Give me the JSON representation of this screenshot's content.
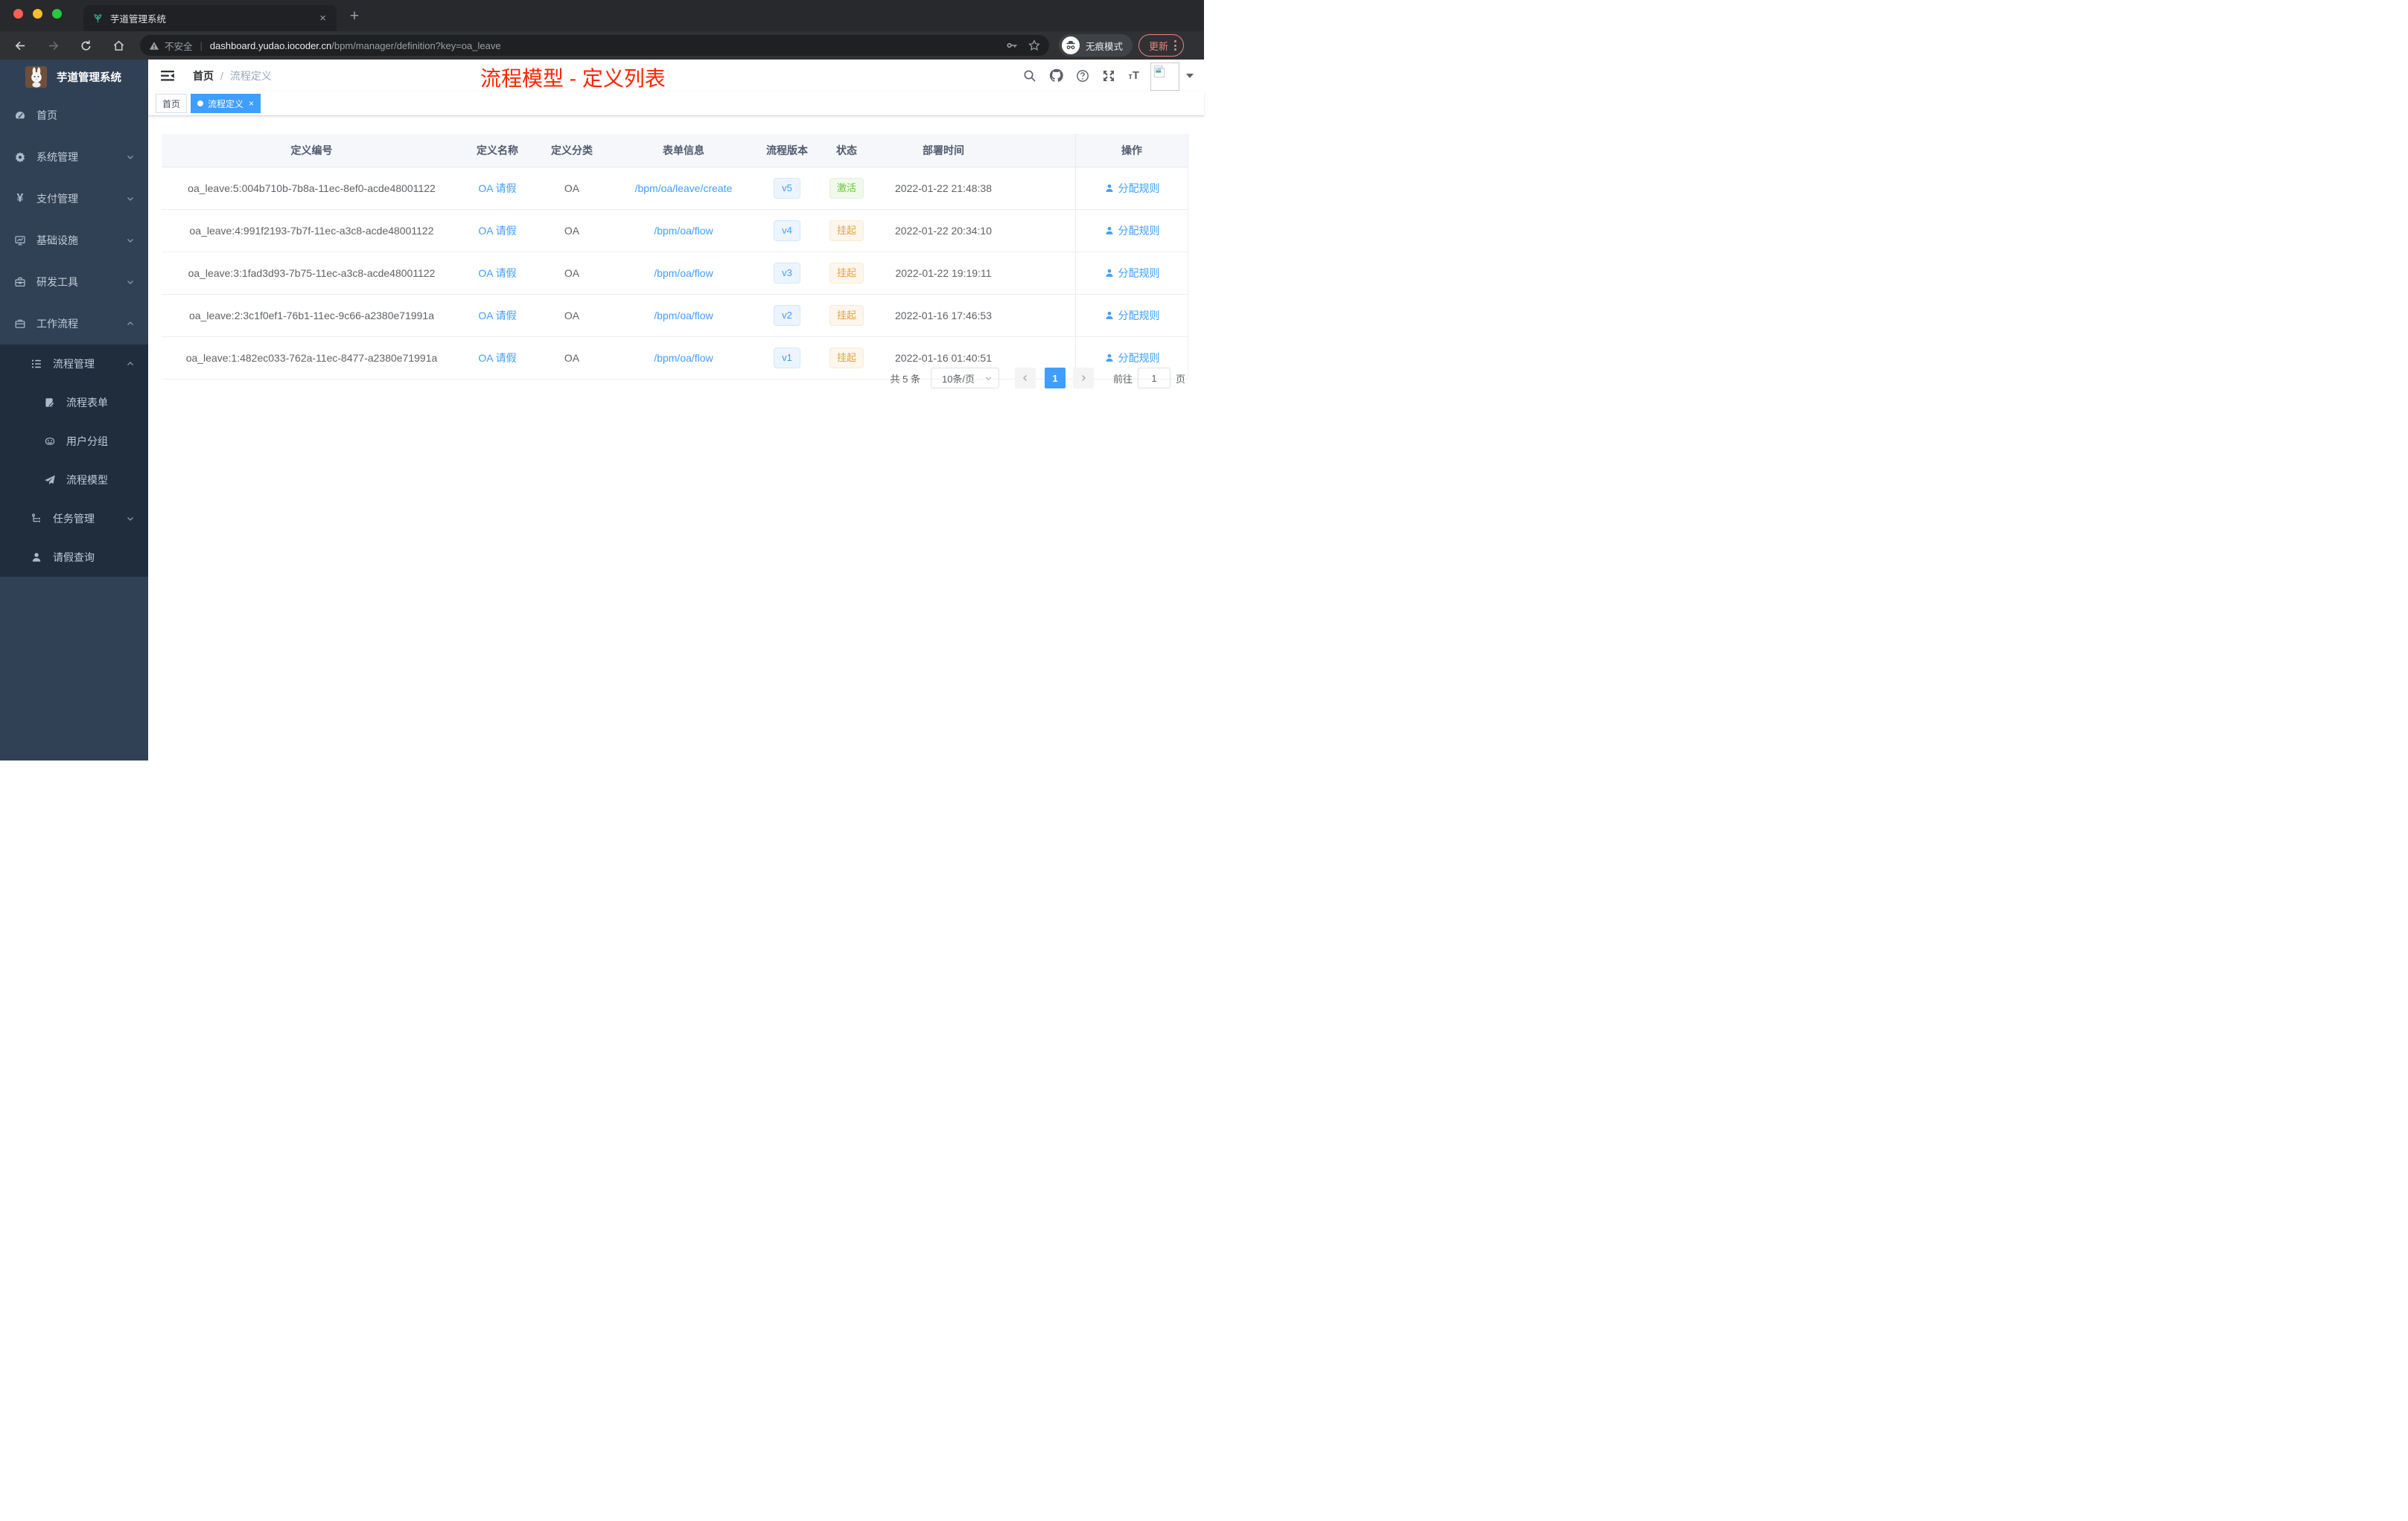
{
  "browser": {
    "tab": {
      "title": "芋道管理系统",
      "close_icon": "×",
      "favicon": "seedling-icon"
    },
    "new_tab_icon": "+",
    "address": {
      "security_label": "不安全",
      "separator": "|",
      "host": "dashboard.yudao.iocoder.cn",
      "path": "/bpm/manager/definition?key=oa_leave"
    },
    "incognito_label": "无痕模式",
    "update_button": "更新"
  },
  "sidebar": {
    "app_title": "芋道管理系统",
    "menu": [
      {
        "name": "home",
        "label": "首页",
        "icon": "dashboard-icon",
        "level": 1
      },
      {
        "name": "system-management",
        "label": "系统管理",
        "icon": "gear-icon",
        "level": 1,
        "chevron": "down"
      },
      {
        "name": "payment-management",
        "label": "支付管理",
        "icon": "yen-icon",
        "level": 1,
        "chevron": "down"
      },
      {
        "name": "infrastructure",
        "label": "基础设施",
        "icon": "monitor-icon",
        "level": 1,
        "chevron": "down"
      },
      {
        "name": "dev-tools",
        "label": "研发工具",
        "icon": "toolbox-icon",
        "level": 1,
        "chevron": "down"
      },
      {
        "name": "workflow",
        "label": "工作流程",
        "icon": "briefcase-icon",
        "level": 1,
        "chevron": "up"
      },
      {
        "name": "process-management",
        "label": "流程管理",
        "icon": "flow-list-icon",
        "level": 2,
        "chevron": "up",
        "in_submenu": true
      },
      {
        "name": "process-form",
        "label": "流程表单",
        "icon": "form-icon",
        "level": 3,
        "in_submenu": true
      },
      {
        "name": "user-group",
        "label": "用户分组",
        "icon": "user-group-icon",
        "level": 3,
        "in_submenu": true
      },
      {
        "name": "process-model",
        "label": "流程模型",
        "icon": "paper-plane-icon",
        "level": 3,
        "in_submenu": true
      },
      {
        "name": "task-management",
        "label": "任务管理",
        "icon": "tree-icon",
        "level": 2,
        "chevron": "down",
        "in_submenu": true
      },
      {
        "name": "leave-query",
        "label": "请假查询",
        "icon": "person-icon",
        "level": 2,
        "in_submenu": true
      }
    ]
  },
  "navbar": {
    "breadcrumb": {
      "items": [
        "首页",
        "流程定义"
      ],
      "separator": "/"
    },
    "annotation": "流程模型 - 定义列表"
  },
  "tags": [
    {
      "label": "首页",
      "active": false
    },
    {
      "label": "流程定义",
      "active": true,
      "close_icon": "×"
    }
  ],
  "table": {
    "columns": [
      "定义编号",
      "定义名称",
      "定义分类",
      "表单信息",
      "流程版本",
      "状态",
      "部署时间",
      "操作"
    ],
    "rows": [
      {
        "id": "oa_leave:5:004b710b-7b8a-11ec-8ef0-acde48001122",
        "name": "OA 请假",
        "category": "OA",
        "form": "/bpm/oa/leave/create",
        "version": "v5",
        "status": "激活",
        "status_type": "success",
        "time": "2022-01-22 21:48:38",
        "action": "分配规则"
      },
      {
        "id": "oa_leave:4:991f2193-7b7f-11ec-a3c8-acde48001122",
        "name": "OA 请假",
        "category": "OA",
        "form": "/bpm/oa/flow",
        "version": "v4",
        "status": "挂起",
        "status_type": "warning",
        "time": "2022-01-22 20:34:10",
        "action": "分配规则"
      },
      {
        "id": "oa_leave:3:1fad3d93-7b75-11ec-a3c8-acde48001122",
        "name": "OA 请假",
        "category": "OA",
        "form": "/bpm/oa/flow",
        "version": "v3",
        "status": "挂起",
        "status_type": "warning",
        "time": "2022-01-22 19:19:11",
        "action": "分配规则"
      },
      {
        "id": "oa_leave:2:3c1f0ef1-76b1-11ec-9c66-a2380e71991a",
        "name": "OA 请假",
        "category": "OA",
        "form": "/bpm/oa/flow",
        "version": "v2",
        "status": "挂起",
        "status_type": "warning",
        "time": "2022-01-16 17:46:53",
        "action": "分配规则"
      },
      {
        "id": "oa_leave:1:482ec033-762a-11ec-8477-a2380e71991a",
        "name": "OA 请假",
        "category": "OA",
        "form": "/bpm/oa/flow",
        "version": "v1",
        "status": "挂起",
        "status_type": "warning",
        "time": "2022-01-16 01:40:51",
        "action": "分配规则"
      }
    ]
  },
  "pagination": {
    "total": "共 5 条",
    "page_size": "10条/页",
    "current": "1",
    "goto_label": "前往",
    "goto_value": "1",
    "goto_unit": "页"
  },
  "colors": {
    "accent": "#409eff",
    "annotation_red": "#ff2400",
    "success_green": "#67c23a",
    "warning_orange": "#e6a23c",
    "sidebar_bg": "#304156",
    "submenu_bg": "#1f2d3d"
  }
}
